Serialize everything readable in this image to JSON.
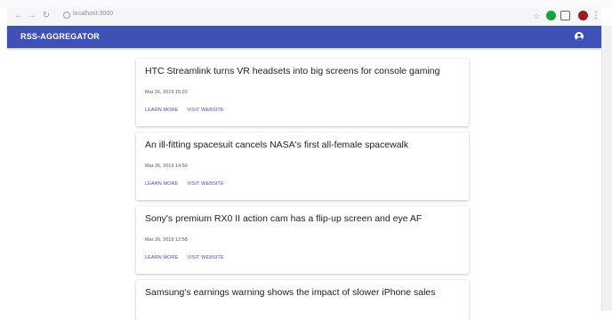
{
  "browser": {
    "url": "localhost:3000",
    "icons": [
      "back-arrow-icon",
      "forward-arrow-icon",
      "reload-icon",
      "site-info-icon",
      "bookmark-star-icon",
      "extension-green-icon",
      "extension-shield-icon",
      "profile-avatar-icon",
      "menu-dots-icon"
    ]
  },
  "appbar": {
    "title": "RSS-AGGREGATOR",
    "account_icon": "account-circle-icon",
    "color": "#3f51b5"
  },
  "articles": [
    {
      "title": "HTC Streamlink turns VR headsets into big screens for console gaming",
      "date": "Mar 26, 2019 15:20",
      "learn_more": "LEARN MORE",
      "visit_website": "VISIT WEBSITE"
    },
    {
      "title": "An ill-fitting spacesuit cancels NASA's first all-female spacewalk",
      "date": "Mar 26, 2019 14:50",
      "learn_more": "LEARN MORE",
      "visit_website": "VISIT WEBSITE"
    },
    {
      "title": "Sony's premium RX0 II action cam has a flip-up screen and eye AF",
      "date": "Mar 26, 2019 12:58",
      "learn_more": "LEARN MORE",
      "visit_website": "VISIT WEBSITE"
    },
    {
      "title": "Samsung's earnings warning shows the impact of slower iPhone sales"
    }
  ]
}
